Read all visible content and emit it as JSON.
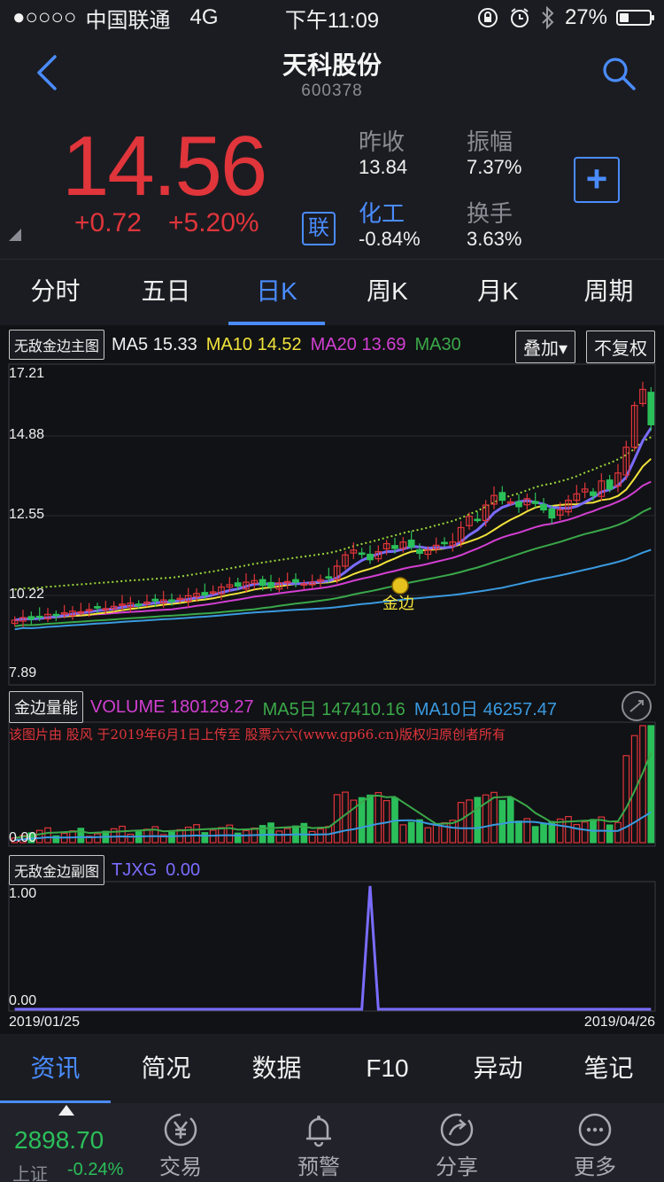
{
  "status_bar": {
    "signal": "●○○○○",
    "carrier": "中国联通",
    "network": "4G",
    "time": "下午11:09",
    "battery_pct": "27%",
    "battery_level": 0.27
  },
  "nav": {
    "title": "天科股份",
    "code": "600378"
  },
  "quote": {
    "price": "14.56",
    "change": "+0.72",
    "change_pct": "+5.20%",
    "lian_label": "联",
    "prev_close_label": "昨收",
    "prev_close": "13.84",
    "amplitude_label": "振幅",
    "amplitude": "7.37%",
    "sector_label": "化工",
    "sector_change": "-0.84%",
    "turnover_label": "换手",
    "turnover": "3.63%",
    "add_label": "+"
  },
  "period_tabs": [
    "分时",
    "五日",
    "日K",
    "周K",
    "月K",
    "周期"
  ],
  "active_period": 2,
  "chart": {
    "main_indicator_chip": "无敌金边主图",
    "ma5_label": "MA5",
    "ma5_value": "15.33",
    "ma10_label": "MA10",
    "ma10_value": "14.52",
    "ma20_label": "MA20",
    "ma20_value": "13.69",
    "ma30_label": "MA30",
    "overlay_label": "叠加▾",
    "no_adjust_label": "不复权",
    "y_ticks": [
      "17.21",
      "14.88",
      "12.55",
      "10.22",
      "7.89"
    ],
    "marker_label": "金边",
    "volume_chip": "金边量能",
    "volume_label": "VOLUME",
    "volume_value": "180129.27",
    "vol_ma5_label": "MA5日",
    "vol_ma5_value": "147410.16",
    "vol_ma10_label": "MA10日",
    "vol_ma10_value": "46257.47",
    "volume_zero": "0.00",
    "watermark": "该图片由 股风 于2019年6月1日上传至 股票六六(www.gp66.cn)版权归原创者所有",
    "sub_chip": "无敌金边副图",
    "sub_label": "TJXG",
    "sub_value": "0.00",
    "sub_ticks": [
      "1.00",
      "0.00"
    ],
    "date_start": "2019/01/25",
    "date_end": "2019/04/26",
    "colors": {
      "up": "#e0353b",
      "down": "#2bbf5a",
      "ma5": "#f0f0f0",
      "ma10": "#f2e33b",
      "ma20": "#d23fd2",
      "ma30": "#3aa84a",
      "ma60": "#3a9ae0",
      "blue_line": "#7a6cff"
    }
  },
  "chart_data": {
    "type": "candlestick",
    "xlabel_range": [
      "2019/01/25",
      "2019/04/26"
    ],
    "ylim": [
      7.89,
      17.21
    ],
    "ma": {
      "MA5": 15.33,
      "MA10": 14.52,
      "MA20": 13.69
    },
    "volume": {
      "VOLUME": 180129.27,
      "MA5": 147410.16,
      "MA10": 46257.47
    },
    "tjxg": {
      "value": 0.0,
      "ylim": [
        0.0,
        1.0
      ]
    },
    "closes": [
      9.52,
      9.6,
      9.55,
      9.62,
      9.7,
      9.68,
      9.75,
      9.8,
      9.78,
      9.85,
      9.9,
      9.88,
      9.95,
      10.02,
      10.05,
      10.0,
      10.08,
      10.12,
      10.15,
      10.1,
      10.2,
      10.28,
      10.35,
      10.3,
      10.4,
      10.55,
      10.62,
      10.58,
      10.7,
      10.75,
      10.6,
      10.55,
      10.68,
      10.72,
      10.7,
      10.65,
      10.7,
      10.78,
      10.85,
      11.2,
      11.55,
      11.7,
      11.6,
      11.4,
      11.65,
      11.9,
      11.75,
      11.95,
      11.8,
      11.6,
      11.7,
      11.85,
      11.9,
      11.95,
      12.4,
      12.75,
      12.65,
      13.1,
      13.4,
      13.25,
      13.2,
      13.05,
      13.3,
      13.15,
      12.95,
      12.7,
      12.95,
      13.25,
      13.45,
      13.6,
      13.4,
      13.85,
      13.6,
      14.1,
      14.9,
      16.2,
      16.7,
      15.6
    ]
  },
  "bottom_tabs": [
    "资讯",
    "简况",
    "数据",
    "F10",
    "异动",
    "笔记"
  ],
  "active_bottom_tab": 0,
  "toolbar": {
    "index_value": "2898.70",
    "index_name": "上证",
    "index_change": "-0.24%",
    "items": [
      {
        "label": "交易",
        "icon": "trade-yen-icon"
      },
      {
        "label": "预警",
        "icon": "bell-icon"
      },
      {
        "label": "分享",
        "icon": "share-icon"
      },
      {
        "label": "更多",
        "icon": "more-icon"
      }
    ]
  }
}
